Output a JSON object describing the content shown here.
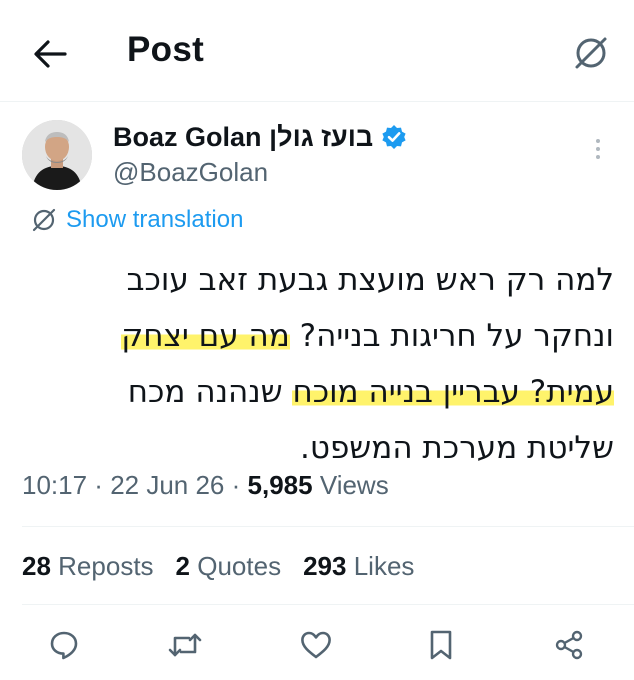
{
  "header": {
    "title": "Post",
    "back_icon": "arrow-left-icon",
    "translate_icon": "translate-slash-icon"
  },
  "author": {
    "display_name": "Boaz Golan בועז גולן",
    "handle": "@BoazGolan",
    "verified": true,
    "badge_color": "#1d9bf0"
  },
  "translation": {
    "label": "Show translation"
  },
  "tweet": {
    "lines": [
      {
        "parts": [
          {
            "text": "למה רק ראש מועצת גבעת זאב עוכב",
            "highlight": false
          }
        ]
      },
      {
        "parts": [
          {
            "text": "ונחקר על חריגות בנייה? ",
            "highlight": false
          },
          {
            "text": "מה עם יצחק",
            "highlight": true
          }
        ]
      },
      {
        "parts": [
          {
            "text": "עמית? עבריין בנייה מוכח",
            "highlight": true
          },
          {
            "text": " שנהנה מכח",
            "highlight": false
          }
        ]
      },
      {
        "parts": [
          {
            "text": "שליטת מערכת המשפט.",
            "highlight": false
          }
        ]
      }
    ],
    "highlight_color": "#fff36b"
  },
  "meta": {
    "time": "10:17",
    "date": "22 Jun 26",
    "views_count": "5,985",
    "views_label": "Views"
  },
  "stats": {
    "reposts_count": "28",
    "reposts_label": "Reposts",
    "quotes_count": "2",
    "quotes_label": "Quotes",
    "likes_count": "293",
    "likes_label": "Likes"
  },
  "actions": [
    "reply-icon",
    "repost-icon",
    "like-icon",
    "bookmark-icon",
    "share-icon"
  ],
  "colors": {
    "accent": "#1d9bf0",
    "text": "#0f1419",
    "secondary": "#536471",
    "divider": "#eff3f4"
  }
}
